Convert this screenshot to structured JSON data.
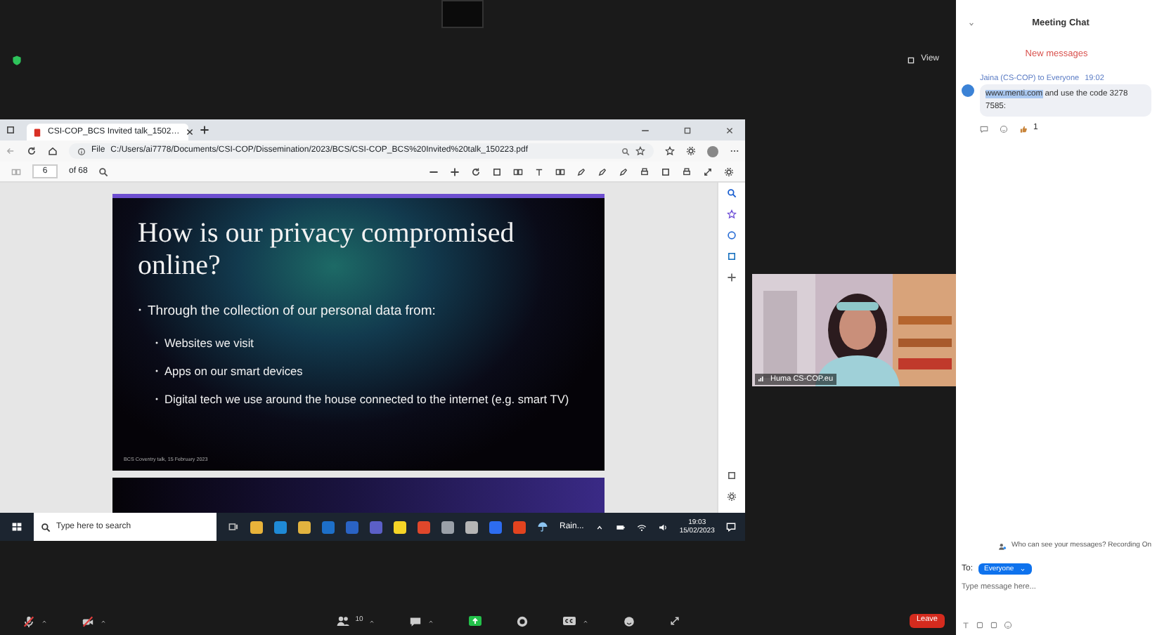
{
  "top_bar": {
    "view_button": "View"
  },
  "browser": {
    "tab_title": "CSI-COP_BCS Invited talk_1502…",
    "address_label": "File",
    "url": "C:/Users/ai7778/Documents/CSI-COP/Dissemination/2023/BCS/CSI-COP_BCS%20Invited%20talk_150223.pdf",
    "page": "6",
    "page_count": "of 68"
  },
  "slide": {
    "title": "How is our privacy compromised online?",
    "bullet": "Through the collection of our personal data from:",
    "sub_bullets": [
      "Websites we visit",
      "Apps on our smart devices",
      "Digital tech we use around the house connected to the internet (e.g. smart TV)"
    ],
    "footer": "BCS Coventry talk, 15 February 2023"
  },
  "taskbar": {
    "search_placeholder": "Type here to search",
    "weather": "Rain...",
    "time": "19:03",
    "date": "15/02/2023",
    "apps": [
      {
        "color": "#e8b33a"
      },
      {
        "color": "#1f8ad6"
      },
      {
        "color": "#e2b33f"
      },
      {
        "color": "#1d6fc9"
      },
      {
        "color": "#2a63c4"
      },
      {
        "color": "#5b5fc7"
      },
      {
        "color": "#f5d426"
      },
      {
        "color": "#e0472b"
      },
      {
        "color": "#9aa0a8"
      },
      {
        "color": "#b5b5b5"
      },
      {
        "color": "#2d6cf0"
      },
      {
        "color": "#e2431f"
      }
    ]
  },
  "video": {
    "name": "Huma CS-COP.eu"
  },
  "toolbar": {
    "mic_muted": true,
    "video_off": true,
    "participants": "10",
    "leave": "Leave"
  },
  "chat": {
    "title": "Meeting Chat",
    "new_messages": "New messages",
    "messages": [
      {
        "sender": "Jaina (CS-COP) to Everyone",
        "time": "19:02",
        "link": "www.menti.com",
        "text": " and use the code 3278 7585:",
        "reaction_count": "1"
      }
    ],
    "visibility_note": "Who can see your messages? Recording On",
    "to_label": "To:",
    "recipient": "Everyone",
    "placeholder": "Type message here..."
  }
}
